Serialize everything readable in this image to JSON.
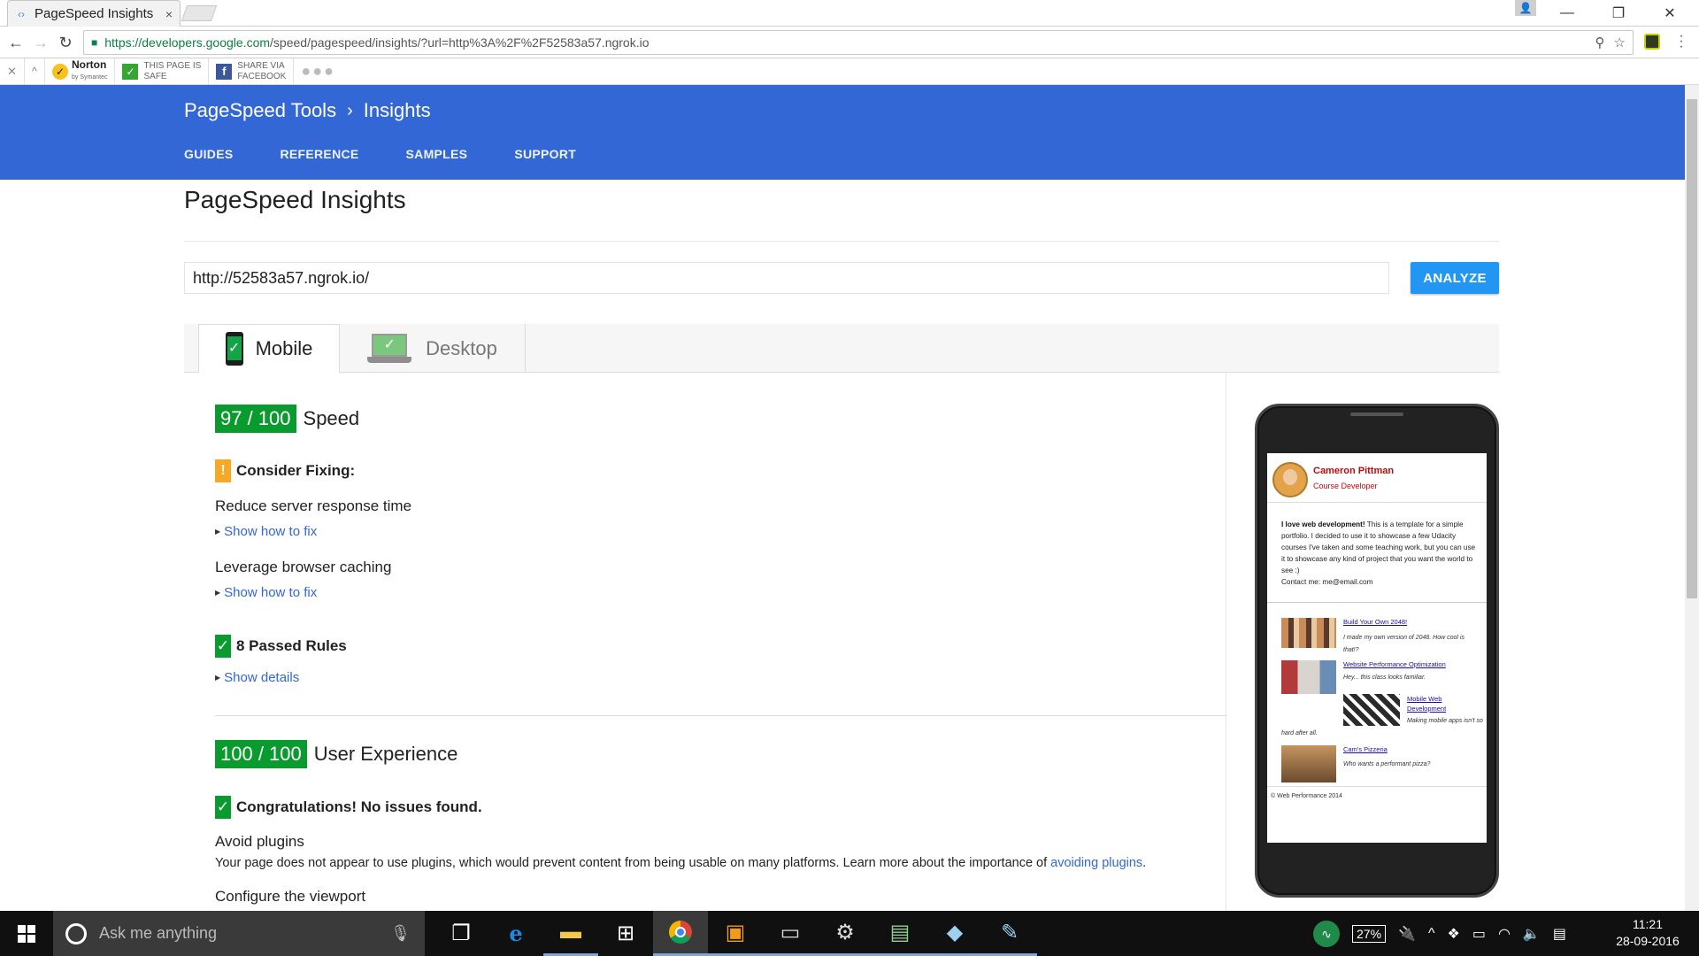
{
  "browser": {
    "tab_title": "PageSpeed Insights",
    "tab_close": "×",
    "url_host": "https://developers.google.com",
    "url_path": "/speed/pagespeed/insights/?url=http%3A%2F%2F52583a57.ngrok.io",
    "window_controls": {
      "minimize": "—",
      "restore": "❐",
      "close": "✕"
    }
  },
  "norton_toolbar": {
    "close": "✕",
    "collapse": "^",
    "norton_label": "Norton",
    "norton_sub": "by Symantec",
    "safe_line1": "THIS PAGE IS",
    "safe_line2": "SAFE",
    "share_line1": "SHARE VIA",
    "share_line2": "FACEBOOK",
    "more": "●●●"
  },
  "header": {
    "breadcrumb_parent": "PageSpeed Tools",
    "breadcrumb_separator": "›",
    "breadcrumb_current": "Insights",
    "nav": [
      "GUIDES",
      "REFERENCE",
      "SAMPLES",
      "SUPPORT"
    ]
  },
  "main": {
    "title": "PageSpeed Insights",
    "url_value": "http://52583a57.ngrok.io/",
    "analyze_label": "ANALYZE",
    "tabs": {
      "mobile": "Mobile",
      "desktop": "Desktop"
    }
  },
  "speed": {
    "score": "97 / 100",
    "label": "Speed",
    "consider_heading": "Consider Fixing:",
    "rules": [
      {
        "title": "Reduce server response time",
        "link": "Show how to fix"
      },
      {
        "title": "Leverage browser caching",
        "link": "Show how to fix"
      }
    ],
    "passed_heading": "8 Passed Rules",
    "passed_link": "Show details"
  },
  "ux": {
    "score": "100 / 100",
    "label": "User Experience",
    "congrats": "Congratulations! No issues found.",
    "rule1_title": "Avoid plugins",
    "rule1_desc": "Your page does not appear to use plugins, which would prevent content from being usable on many platforms. Learn more about the importance of ",
    "rule1_link": "avoiding plugins",
    "rule1_end": ".",
    "rule2_title": "Configure the viewport"
  },
  "preview": {
    "name": "Cameron Pittman",
    "role": "Course Developer",
    "bio_bold": "I love web development!",
    "bio_text": " This is a template for a simple portfolio. I decided to use it to showcase a few Udacity courses I've taken and some teaching work, but you can use it to showcase any kind of project that you want the world to see :)",
    "contact": "Contact me: me@email.com",
    "projects": [
      {
        "link": "Build Your Own 2048!",
        "desc": "I made my own version of 2048. How cool is that!?"
      },
      {
        "link": "Website Performance Optimization",
        "desc": "Hey... this class looks familiar."
      },
      {
        "link": "Mobile Web Development",
        "desc": "Making mobile apps isn't so hard after all."
      },
      {
        "link": "Cam's Pizzeria",
        "desc": "Who wants a performant pizza?"
      }
    ],
    "footer": "© Web Performance 2014"
  },
  "taskbar": {
    "search_placeholder": "Ask me anything",
    "battery": "27%",
    "time": "11:21",
    "date": "28-09-2016"
  },
  "colors": {
    "header": "#3367d6",
    "score": "#0a9b2e",
    "warn": "#f9a825",
    "analyze": "#2196f3"
  }
}
